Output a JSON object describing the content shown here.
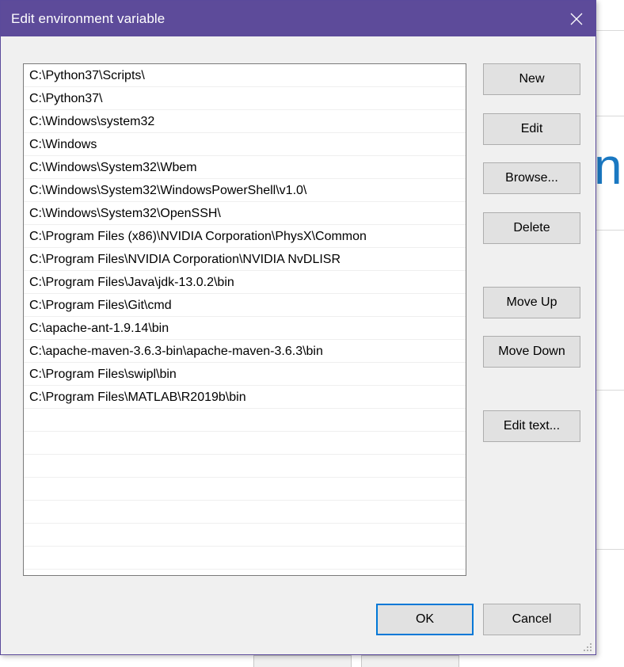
{
  "dialog": {
    "title": "Edit environment variable",
    "accent_color": "#5d4b9a",
    "close_icon": "close-icon"
  },
  "paths": [
    "C:\\Python37\\Scripts\\",
    "C:\\Python37\\",
    "C:\\Windows\\system32",
    "C:\\Windows",
    "C:\\Windows\\System32\\Wbem",
    "C:\\Windows\\System32\\WindowsPowerShell\\v1.0\\",
    "C:\\Windows\\System32\\OpenSSH\\",
    "C:\\Program Files (x86)\\NVIDIA Corporation\\PhysX\\Common",
    "C:\\Program Files\\NVIDIA Corporation\\NVIDIA NvDLISR",
    "C:\\Program Files\\Java\\jdk-13.0.2\\bin",
    "C:\\Program Files\\Git\\cmd",
    "C:\\apache-ant-1.9.14\\bin",
    "C:\\apache-maven-3.6.3-bin\\apache-maven-3.6.3\\bin",
    "C:\\Program Files\\swipl\\bin",
    "C:\\Program Files\\MATLAB\\R2019b\\bin"
  ],
  "empty_rows": 7,
  "buttons": {
    "new": "New",
    "edit": "Edit",
    "browse": "Browse...",
    "delete": "Delete",
    "move_up": "Move Up",
    "move_down": "Move Down",
    "edit_text": "Edit text...",
    "ok": "OK",
    "cancel": "Cancel"
  },
  "background": {
    "partial_glyph": "nc",
    "glyph_color": "#1a78c2"
  }
}
